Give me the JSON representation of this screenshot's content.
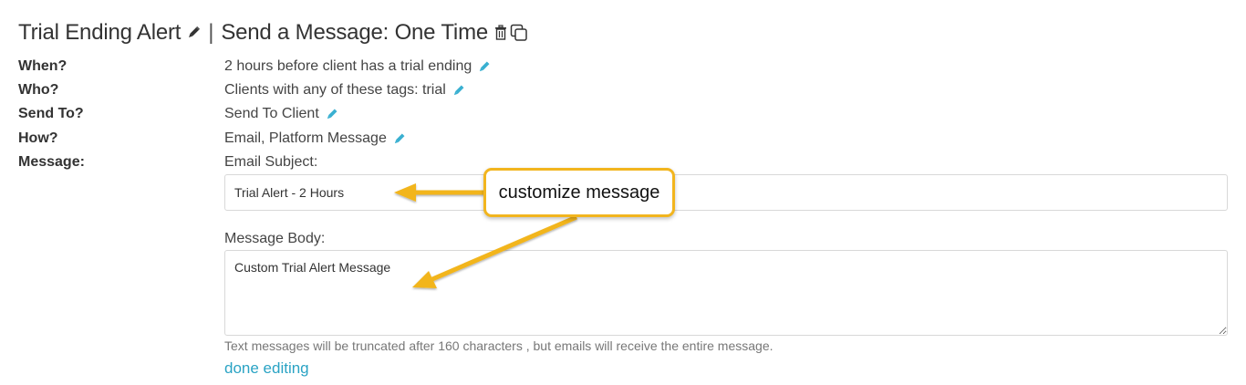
{
  "header": {
    "title": "Trial Ending Alert",
    "separator": "|",
    "subtitle": "Send a Message: One Time",
    "icons": {
      "edit": "pencil-icon",
      "delete": "trash-icon",
      "duplicate": "copy-icon"
    }
  },
  "fields": {
    "when": {
      "label": "When?",
      "value": "2 hours before client has a trial ending"
    },
    "who": {
      "label": "Who?",
      "value": "Clients with any of these tags: trial"
    },
    "send_to": {
      "label": "Send To?",
      "value": "Send To Client"
    },
    "how": {
      "label": "How?",
      "value": "Email, Platform Message"
    },
    "message": {
      "label": "Message:"
    }
  },
  "email_subject": {
    "label": "Email Subject:",
    "value": "Trial Alert - 2 Hours"
  },
  "message_body": {
    "label": "Message Body:",
    "value": "Custom Trial Alert Message"
  },
  "help_text": "Text messages will be truncated after 160 characters , but emails will receive the entire message.",
  "done_link": "done editing",
  "annotation": {
    "callout_text": "customize message"
  },
  "colors": {
    "accent_link": "#2aa3c4",
    "callout_border": "#f2b51e",
    "text": "#333333"
  }
}
